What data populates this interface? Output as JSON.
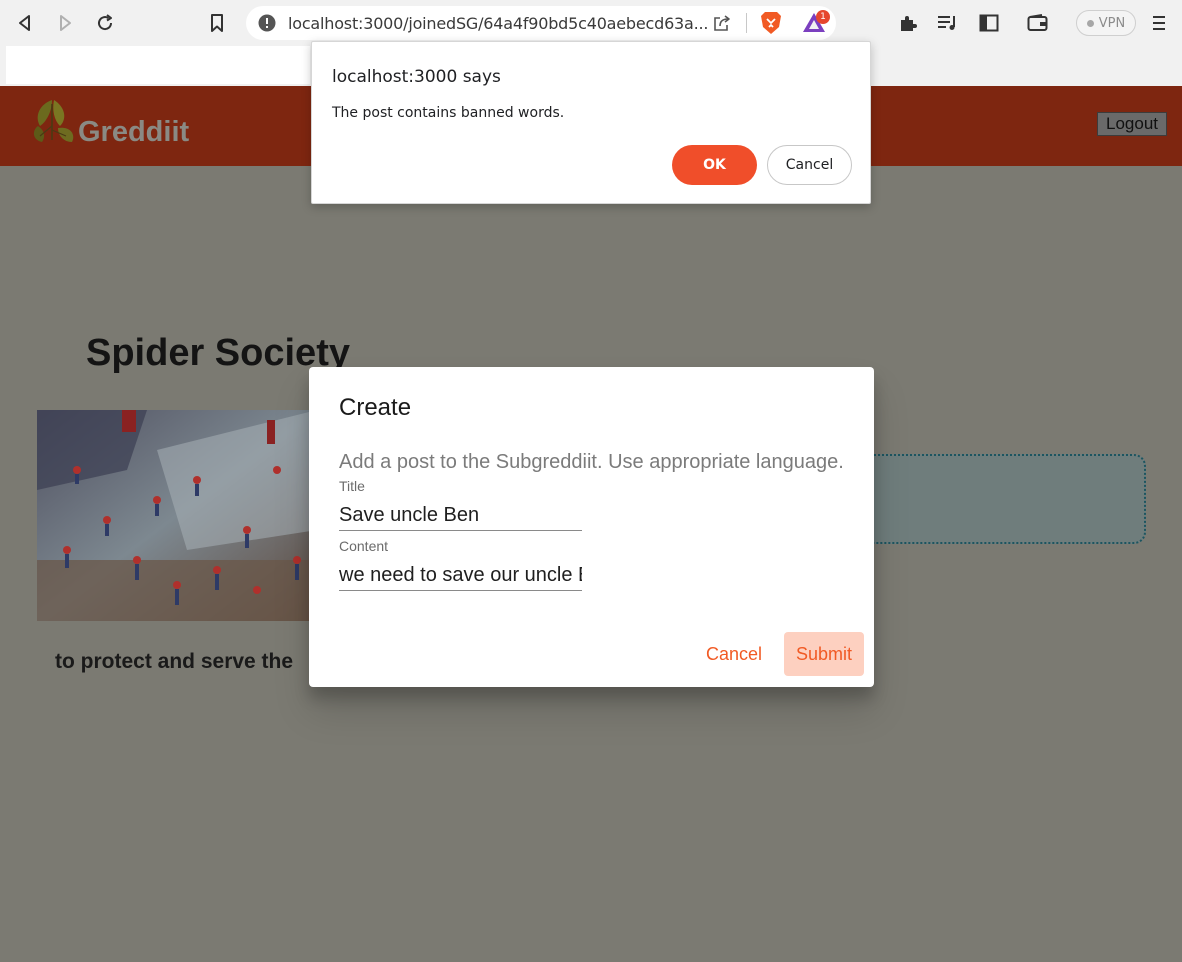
{
  "browser": {
    "url": "localhost:3000/joinedSG/64a4f90bd5c40aebecd63a...",
    "vpn_label": "VPN",
    "rewards_badge": "1"
  },
  "app": {
    "brand": "Greddiit",
    "logout_label": "Logout"
  },
  "page": {
    "title": "Spider Society",
    "tagline": "to protect and serve the"
  },
  "create_dialog": {
    "title": "Create",
    "description": "Add a post to the Subgreddiit. Use appropriate language.",
    "title_label": "Title",
    "title_value": "Save uncle Ben",
    "content_label": "Content",
    "content_value": "we need to save our uncle Ben",
    "cancel_label": "Cancel",
    "submit_label": "Submit"
  },
  "alert": {
    "title": "localhost:3000 says",
    "message": "The post contains banned words.",
    "ok_label": "OK",
    "cancel_label": "Cancel"
  }
}
